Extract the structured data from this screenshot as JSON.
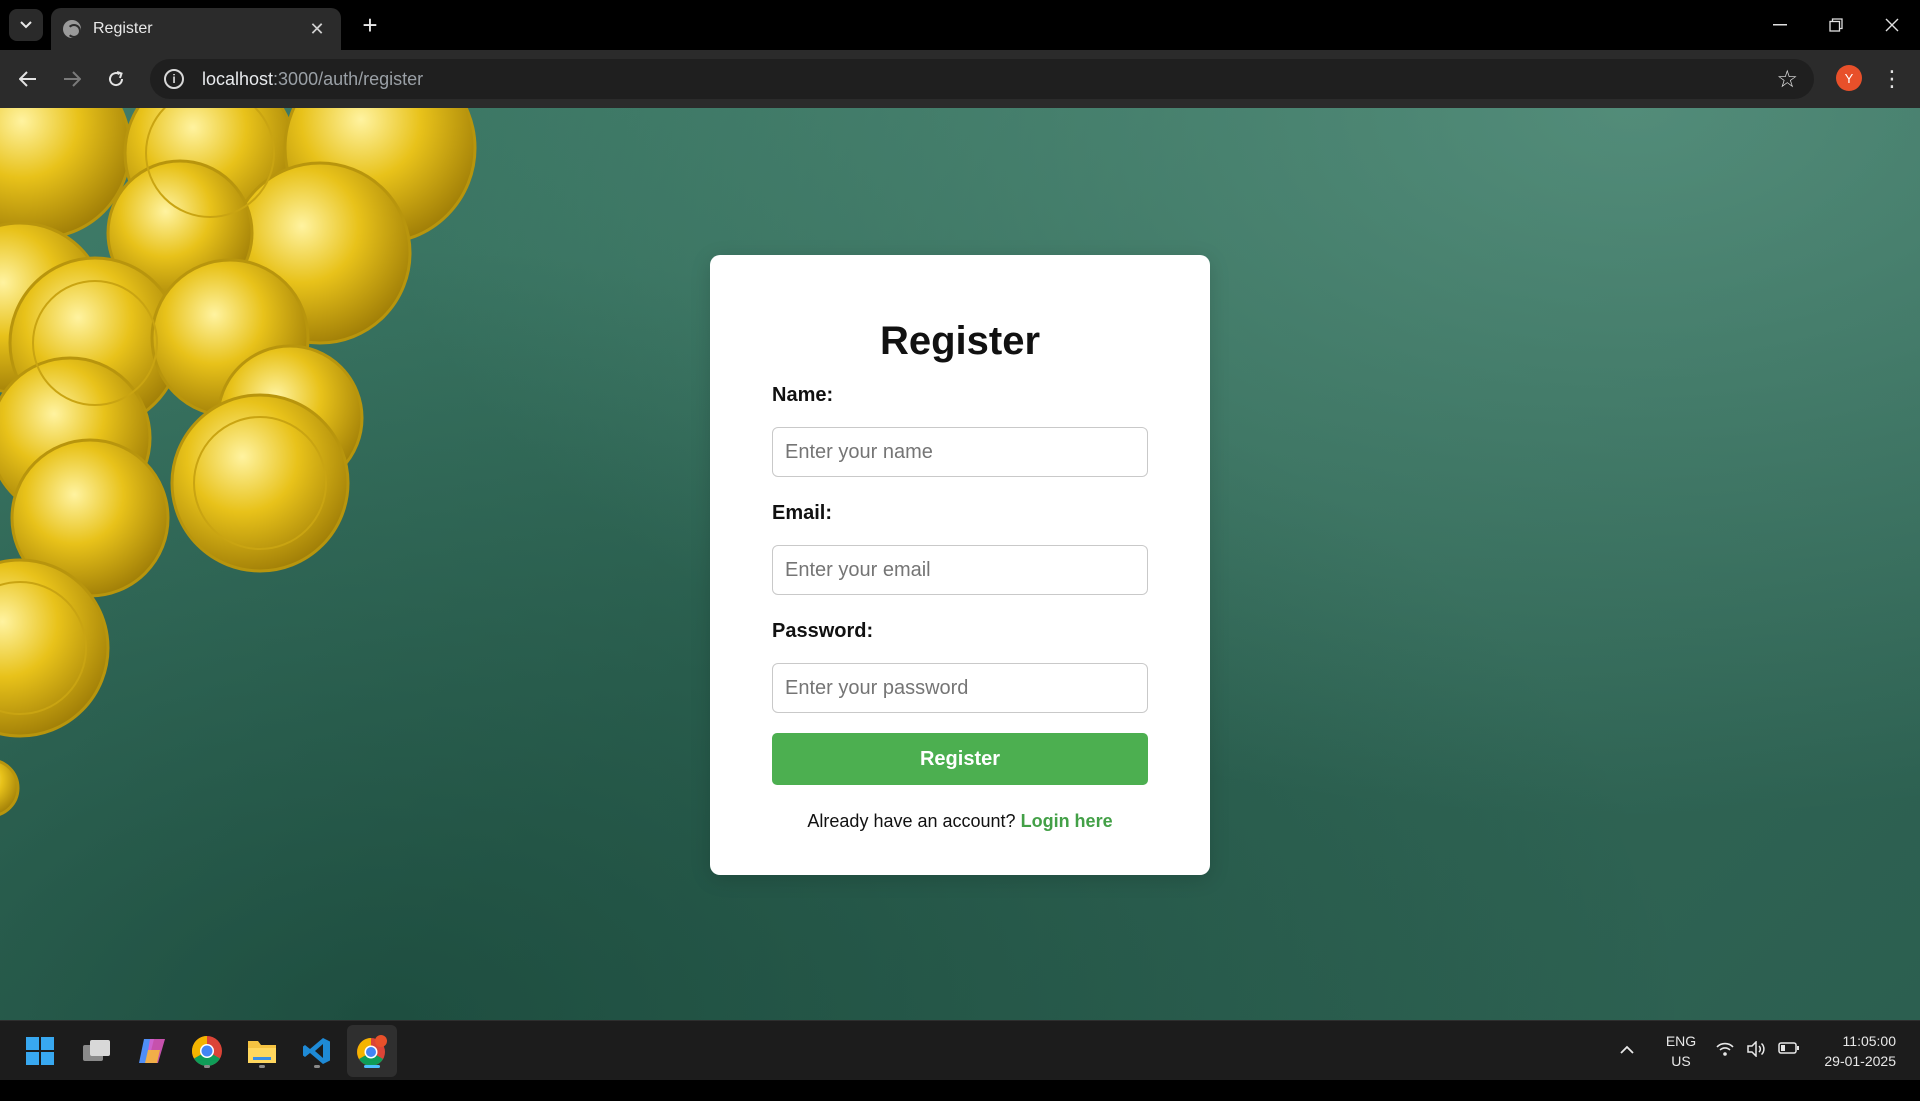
{
  "browser": {
    "tab_title": "Register",
    "tab_close": "✕",
    "new_tab": "+",
    "url_host": "localhost",
    "url_rest": ":3000/auth/register",
    "profile_initial": "Y"
  },
  "form": {
    "title": "Register",
    "name_label": "Name:",
    "name_placeholder": "Enter your name",
    "email_label": "Email:",
    "email_placeholder": "Enter your email",
    "password_label": "Password:",
    "password_placeholder": "Enter your password",
    "submit_label": "Register",
    "login_prompt": "Already have an account?",
    "login_link": "Login here"
  },
  "colors": {
    "accent_green": "#4caf50",
    "link_green": "#43a047",
    "background_teal": "#35705e"
  },
  "taskbar": {
    "apps": [
      "windows-start-icon",
      "task-view-icon",
      "copilot-icon",
      "chrome-icon",
      "file-explorer-icon",
      "vscode-icon",
      "chrome-profile-icon"
    ],
    "lang_line1": "ENG",
    "lang_line2": "US",
    "time": "11:05:00",
    "date": "29-01-2025"
  }
}
